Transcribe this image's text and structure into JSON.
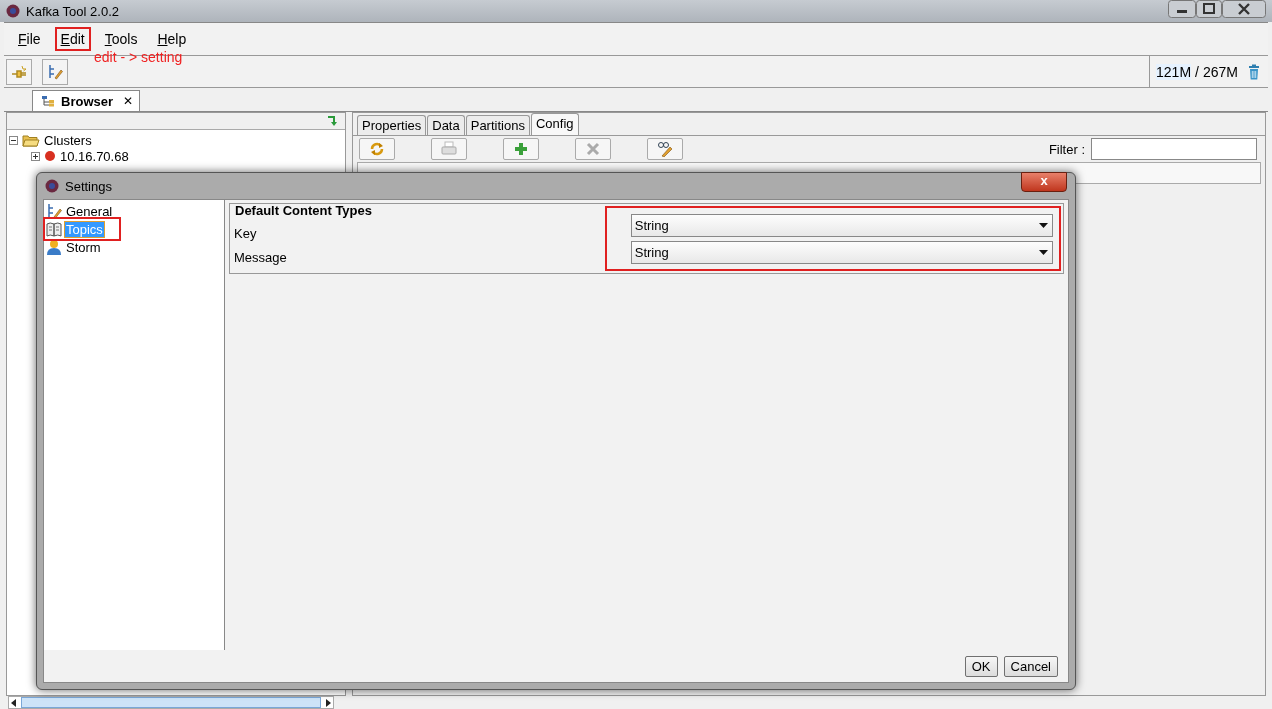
{
  "window": {
    "title": "Kafka Tool  2.0.2"
  },
  "menu": [
    {
      "label": "File",
      "highlighted": false
    },
    {
      "label": "Edit",
      "highlighted": true
    },
    {
      "label": "Tools",
      "highlighted": false
    },
    {
      "label": "Help",
      "highlighted": false
    }
  ],
  "annotation": "edit - > setting",
  "memory": {
    "used": "121M",
    "separator": "/",
    "total": "267M"
  },
  "document_tabs": [
    {
      "label": "Browser",
      "selected": true,
      "close": "✕"
    }
  ],
  "browser_tree": [
    {
      "label": "Clusters",
      "expanded": true,
      "children": [
        {
          "label": "10.16.70.68",
          "expanded": false
        }
      ]
    }
  ],
  "detail_tabs": [
    {
      "label": "Properties",
      "selected": false
    },
    {
      "label": "Data",
      "selected": false
    },
    {
      "label": "Partitions",
      "selected": false
    },
    {
      "label": "Config",
      "selected": true
    }
  ],
  "filter": {
    "label": "Filter :"
  },
  "dialog": {
    "title": "Settings",
    "close": "x",
    "categories": [
      {
        "label": "General",
        "kind": "general",
        "selected": false,
        "highlighted": false
      },
      {
        "label": "Topics",
        "kind": "topics",
        "selected": true,
        "highlighted": true
      },
      {
        "label": "Storm",
        "kind": "storm",
        "selected": false,
        "highlighted": false
      }
    ],
    "group": {
      "title": "Default Content Types",
      "highlighted": true,
      "fields": [
        {
          "label": "Key",
          "value": "String"
        },
        {
          "label": "Message",
          "value": "String"
        }
      ]
    },
    "buttons": [
      "OK",
      "Cancel"
    ]
  }
}
